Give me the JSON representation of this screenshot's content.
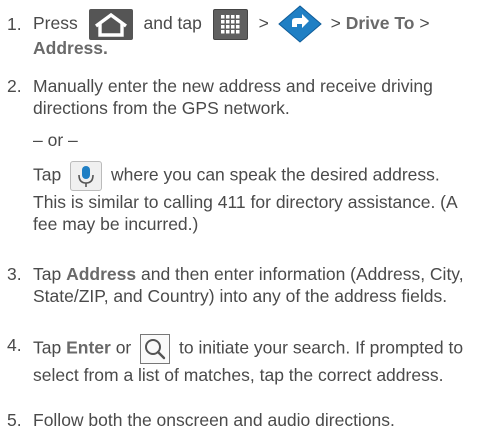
{
  "steps": [
    {
      "number": "1.",
      "t1": "Press",
      "t2": "and tap",
      "t3": ">",
      "t4": ">",
      "t5": "Drive To",
      "t6": ">",
      "t7": "Address."
    },
    {
      "number": "2.",
      "text": "Manually enter the new address and receive driving directions from the GPS network.",
      "or": "– or –",
      "tap": "Tap",
      "voice_text": "where you can speak the desired address. This is similar to calling 411 for directory assistance. (A fee may be incurred.)"
    },
    {
      "number": "3.",
      "tap": "Tap",
      "bold": "Address",
      "text": "and then enter information (Address, City, State/ZIP, and Country) into any of the address fields."
    },
    {
      "number": "4.",
      "tap": "Tap",
      "bold": "Enter",
      "or": "or",
      "text": "to initiate your search. If prompted to select from a list of matches, tap the correct address."
    },
    {
      "number": "5.",
      "text": "Follow both the onscreen and audio directions."
    }
  ],
  "icons": {
    "home": "home-icon",
    "apps": "apps-grid-icon",
    "navigation": "navigation-app-icon",
    "microphone": "microphone-icon",
    "search": "search-icon"
  },
  "colors": {
    "text": "#4a4a4a",
    "icon_dark": "#555555",
    "nav_blue": "#1f7fc4"
  }
}
